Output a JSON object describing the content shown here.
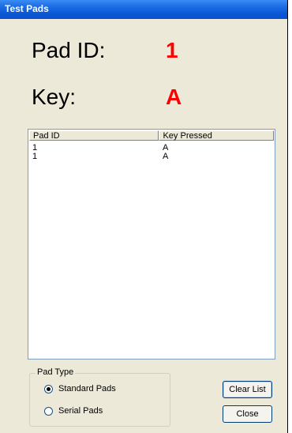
{
  "window": {
    "title": "Test Pads"
  },
  "display": {
    "pad_id_label": "Pad ID:",
    "pad_id_value": "1",
    "key_label": "Key:",
    "key_value": "A"
  },
  "list": {
    "columns": [
      "Pad ID",
      "Key Pressed"
    ],
    "rows": [
      {
        "pad_id": "1",
        "key": "A"
      },
      {
        "pad_id": "1",
        "key": "A"
      }
    ]
  },
  "pad_type": {
    "title": "Pad Type",
    "options": [
      {
        "label": "Standard Pads",
        "selected": true
      },
      {
        "label": "Serial Pads",
        "selected": false
      }
    ]
  },
  "buttons": {
    "clear": "Clear List",
    "close": "Close"
  },
  "colors": {
    "value_red": "#ff0000",
    "titlebar_blue": "#0a58d6"
  }
}
